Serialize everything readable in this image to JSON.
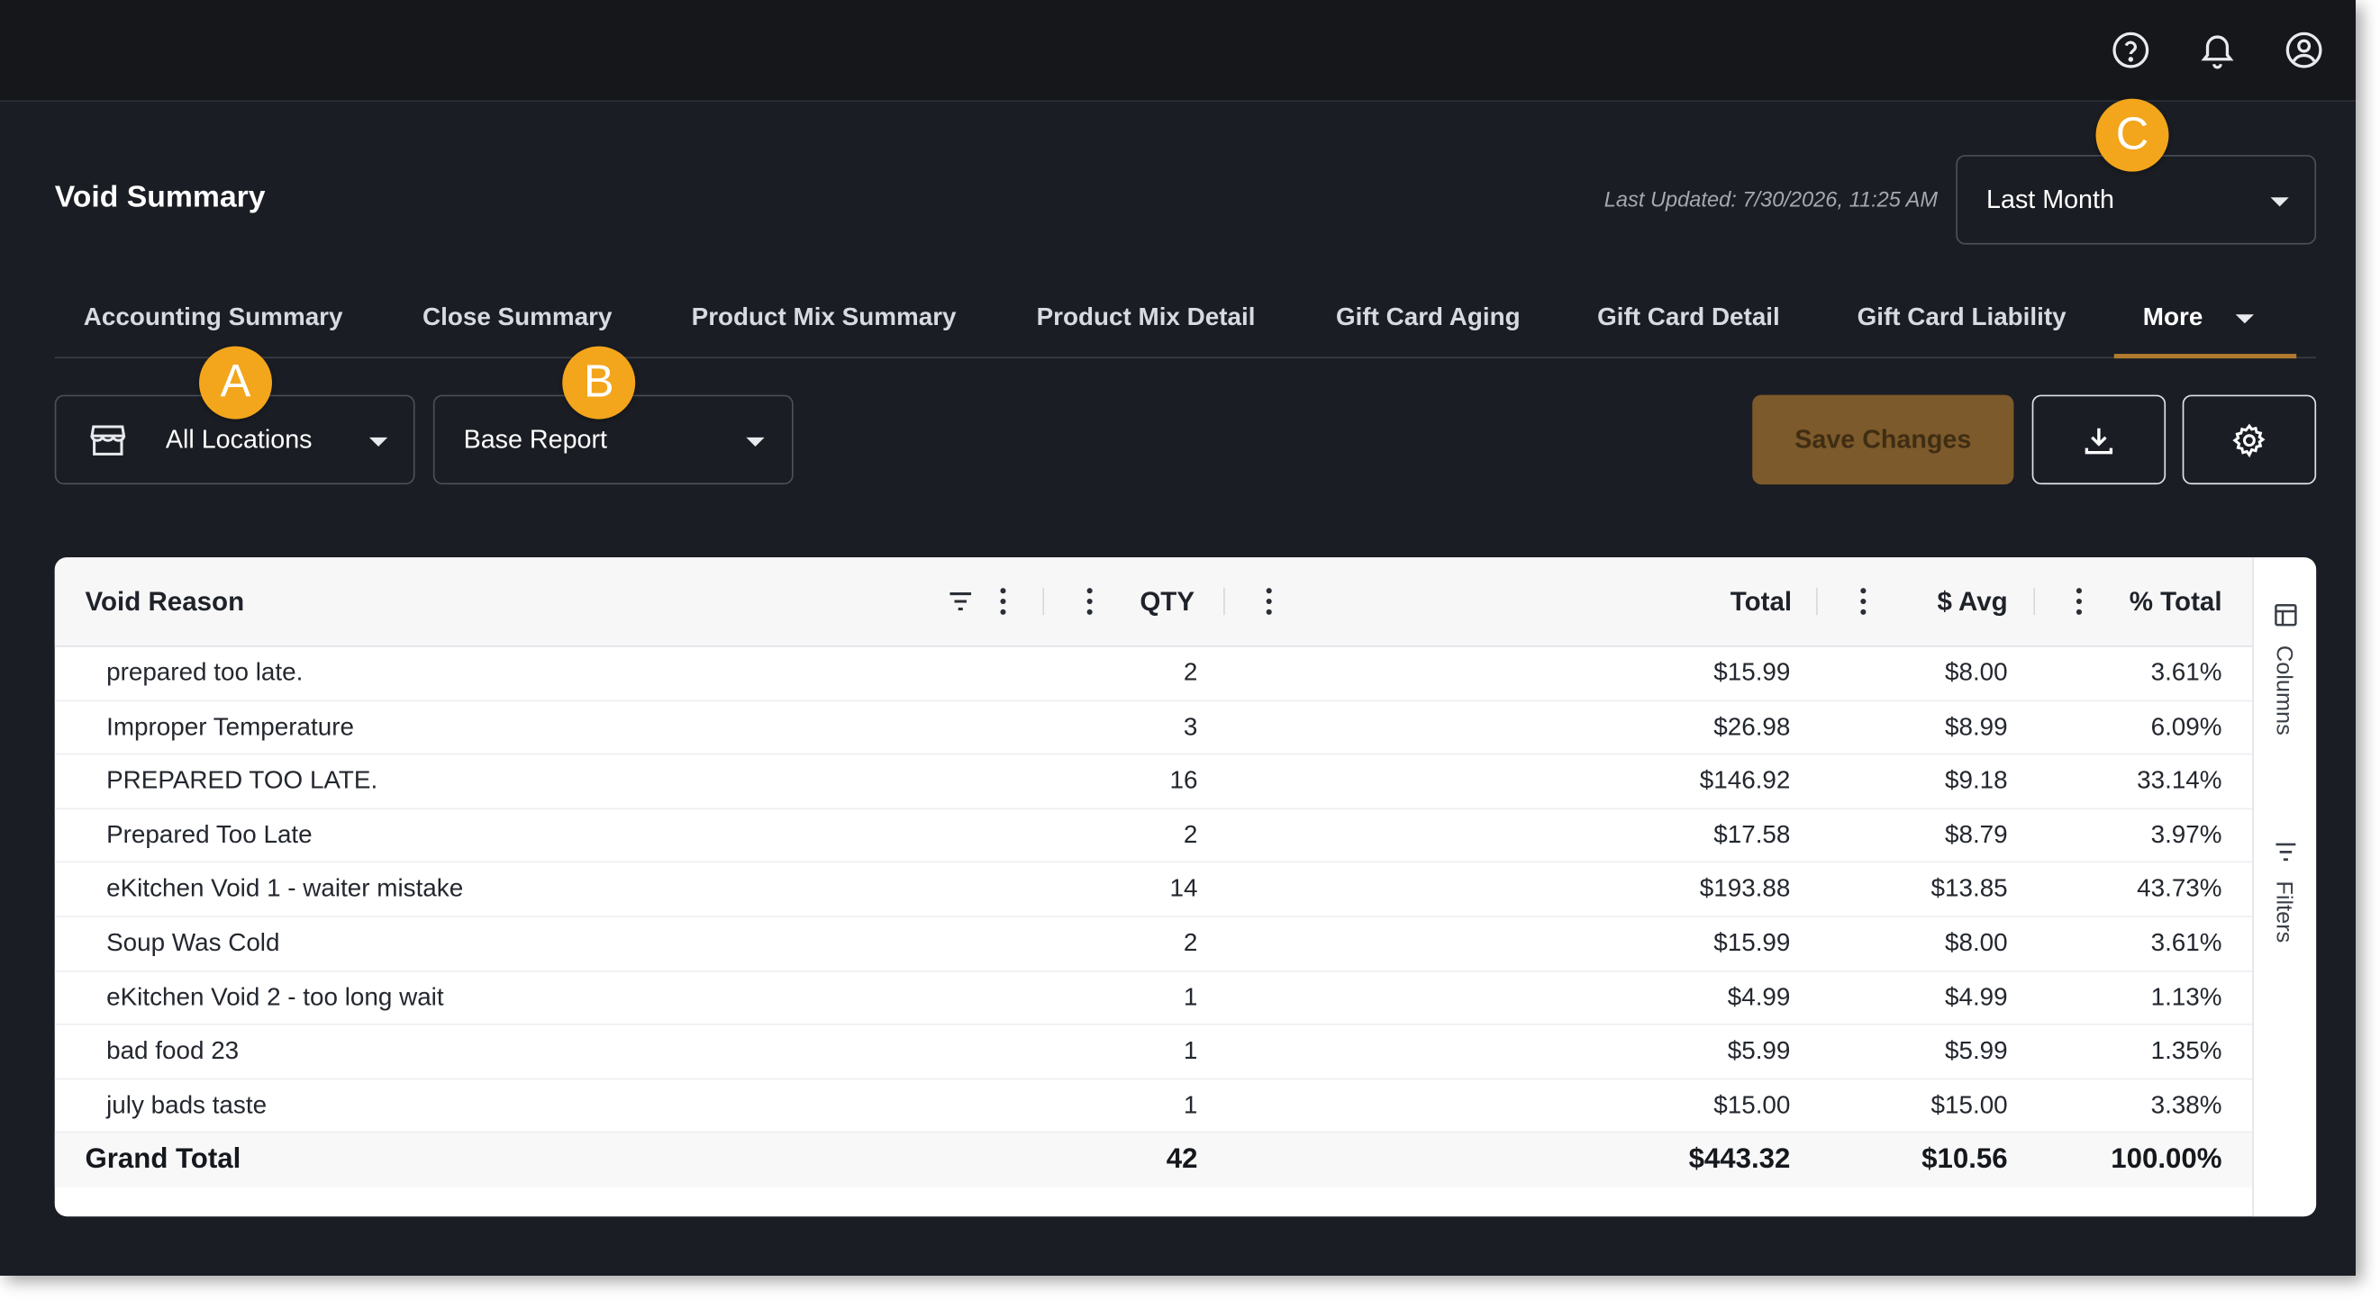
{
  "page": {
    "title": "Void Summary",
    "last_updated": "Last Updated: 7/30/2026, 11:25 AM"
  },
  "date_range": {
    "value": "Last Month"
  },
  "tabs": [
    {
      "label": "Accounting Summary"
    },
    {
      "label": "Close Summary"
    },
    {
      "label": "Product Mix Summary"
    },
    {
      "label": "Product Mix Detail"
    },
    {
      "label": "Gift Card Aging"
    },
    {
      "label": "Gift Card Detail"
    },
    {
      "label": "Gift Card Liability"
    },
    {
      "label": "More"
    }
  ],
  "controls": {
    "location": "All Locations",
    "report": "Base Report",
    "save_label": "Save Changes"
  },
  "badges": {
    "a": "A",
    "b": "B",
    "c": "C"
  },
  "table": {
    "headers": {
      "reason": "Void Reason",
      "qty": "QTY",
      "total": "Total",
      "avg": "$ Avg",
      "pct": "% Total"
    },
    "rows": [
      {
        "reason": "prepared too late.",
        "qty": "2",
        "total": "$15.99",
        "avg": "$8.00",
        "pct": "3.61%"
      },
      {
        "reason": "Improper Temperature",
        "qty": "3",
        "total": "$26.98",
        "avg": "$8.99",
        "pct": "6.09%"
      },
      {
        "reason": "PREPARED TOO LATE.",
        "qty": "16",
        "total": "$146.92",
        "avg": "$9.18",
        "pct": "33.14%"
      },
      {
        "reason": "Prepared Too Late",
        "qty": "2",
        "total": "$17.58",
        "avg": "$8.79",
        "pct": "3.97%"
      },
      {
        "reason": "eKitchen Void 1 - waiter mistake",
        "qty": "14",
        "total": "$193.88",
        "avg": "$13.85",
        "pct": "43.73%"
      },
      {
        "reason": "Soup Was Cold",
        "qty": "2",
        "total": "$15.99",
        "avg": "$8.00",
        "pct": "3.61%"
      },
      {
        "reason": "eKitchen Void 2 - too long wait",
        "qty": "1",
        "total": "$4.99",
        "avg": "$4.99",
        "pct": "1.13%"
      },
      {
        "reason": "bad food 23",
        "qty": "1",
        "total": "$5.99",
        "avg": "$5.99",
        "pct": "1.35%"
      },
      {
        "reason": "july bads taste",
        "qty": "1",
        "total": "$15.00",
        "avg": "$15.00",
        "pct": "3.38%"
      }
    ],
    "grand_total": {
      "label": "Grand Total",
      "qty": "42",
      "total": "$443.32",
      "avg": "$10.56",
      "pct": "100.00%"
    }
  },
  "side_panel": {
    "columns": "Columns",
    "filters": "Filters"
  },
  "colors": {
    "accent": "#b07a2f",
    "badge": "#f3a51c",
    "save_button": "#7d5a2b",
    "app_bg": "#1a1d23"
  }
}
